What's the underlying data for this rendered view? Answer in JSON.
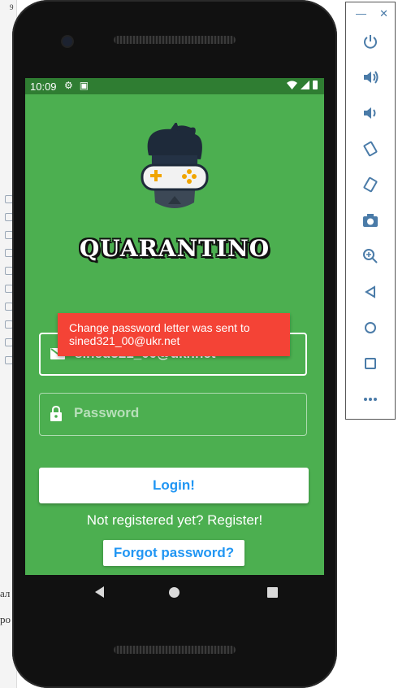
{
  "ide": {
    "left_text_1": "ал",
    "left_text_2": "ро",
    "top_fragment": "9"
  },
  "status_bar": {
    "time": "10:09"
  },
  "app": {
    "brand": "QUARANTINO",
    "email_value": "sined321_00@ukr.net",
    "password_placeholder": "Password",
    "login_label": "Login!",
    "register_text": "Not registered yet? Register!",
    "forgot_label": "Forgot password?",
    "toast_text": "Change password letter was sent to sined321_00@ukr.net"
  },
  "emulator_panel": {
    "minimize": "—",
    "close": "✕",
    "tools": [
      "power-icon",
      "volume-up-icon",
      "volume-down-icon",
      "rotate-left-icon",
      "rotate-right-icon",
      "camera-icon",
      "zoom-icon",
      "back-icon",
      "home-icon",
      "overview-icon",
      "more-icon"
    ]
  },
  "colors": {
    "screen_bg": "#4caf50",
    "status_bg": "#2f7d32",
    "toast_bg": "#f44336",
    "accent": "#2196f3"
  }
}
